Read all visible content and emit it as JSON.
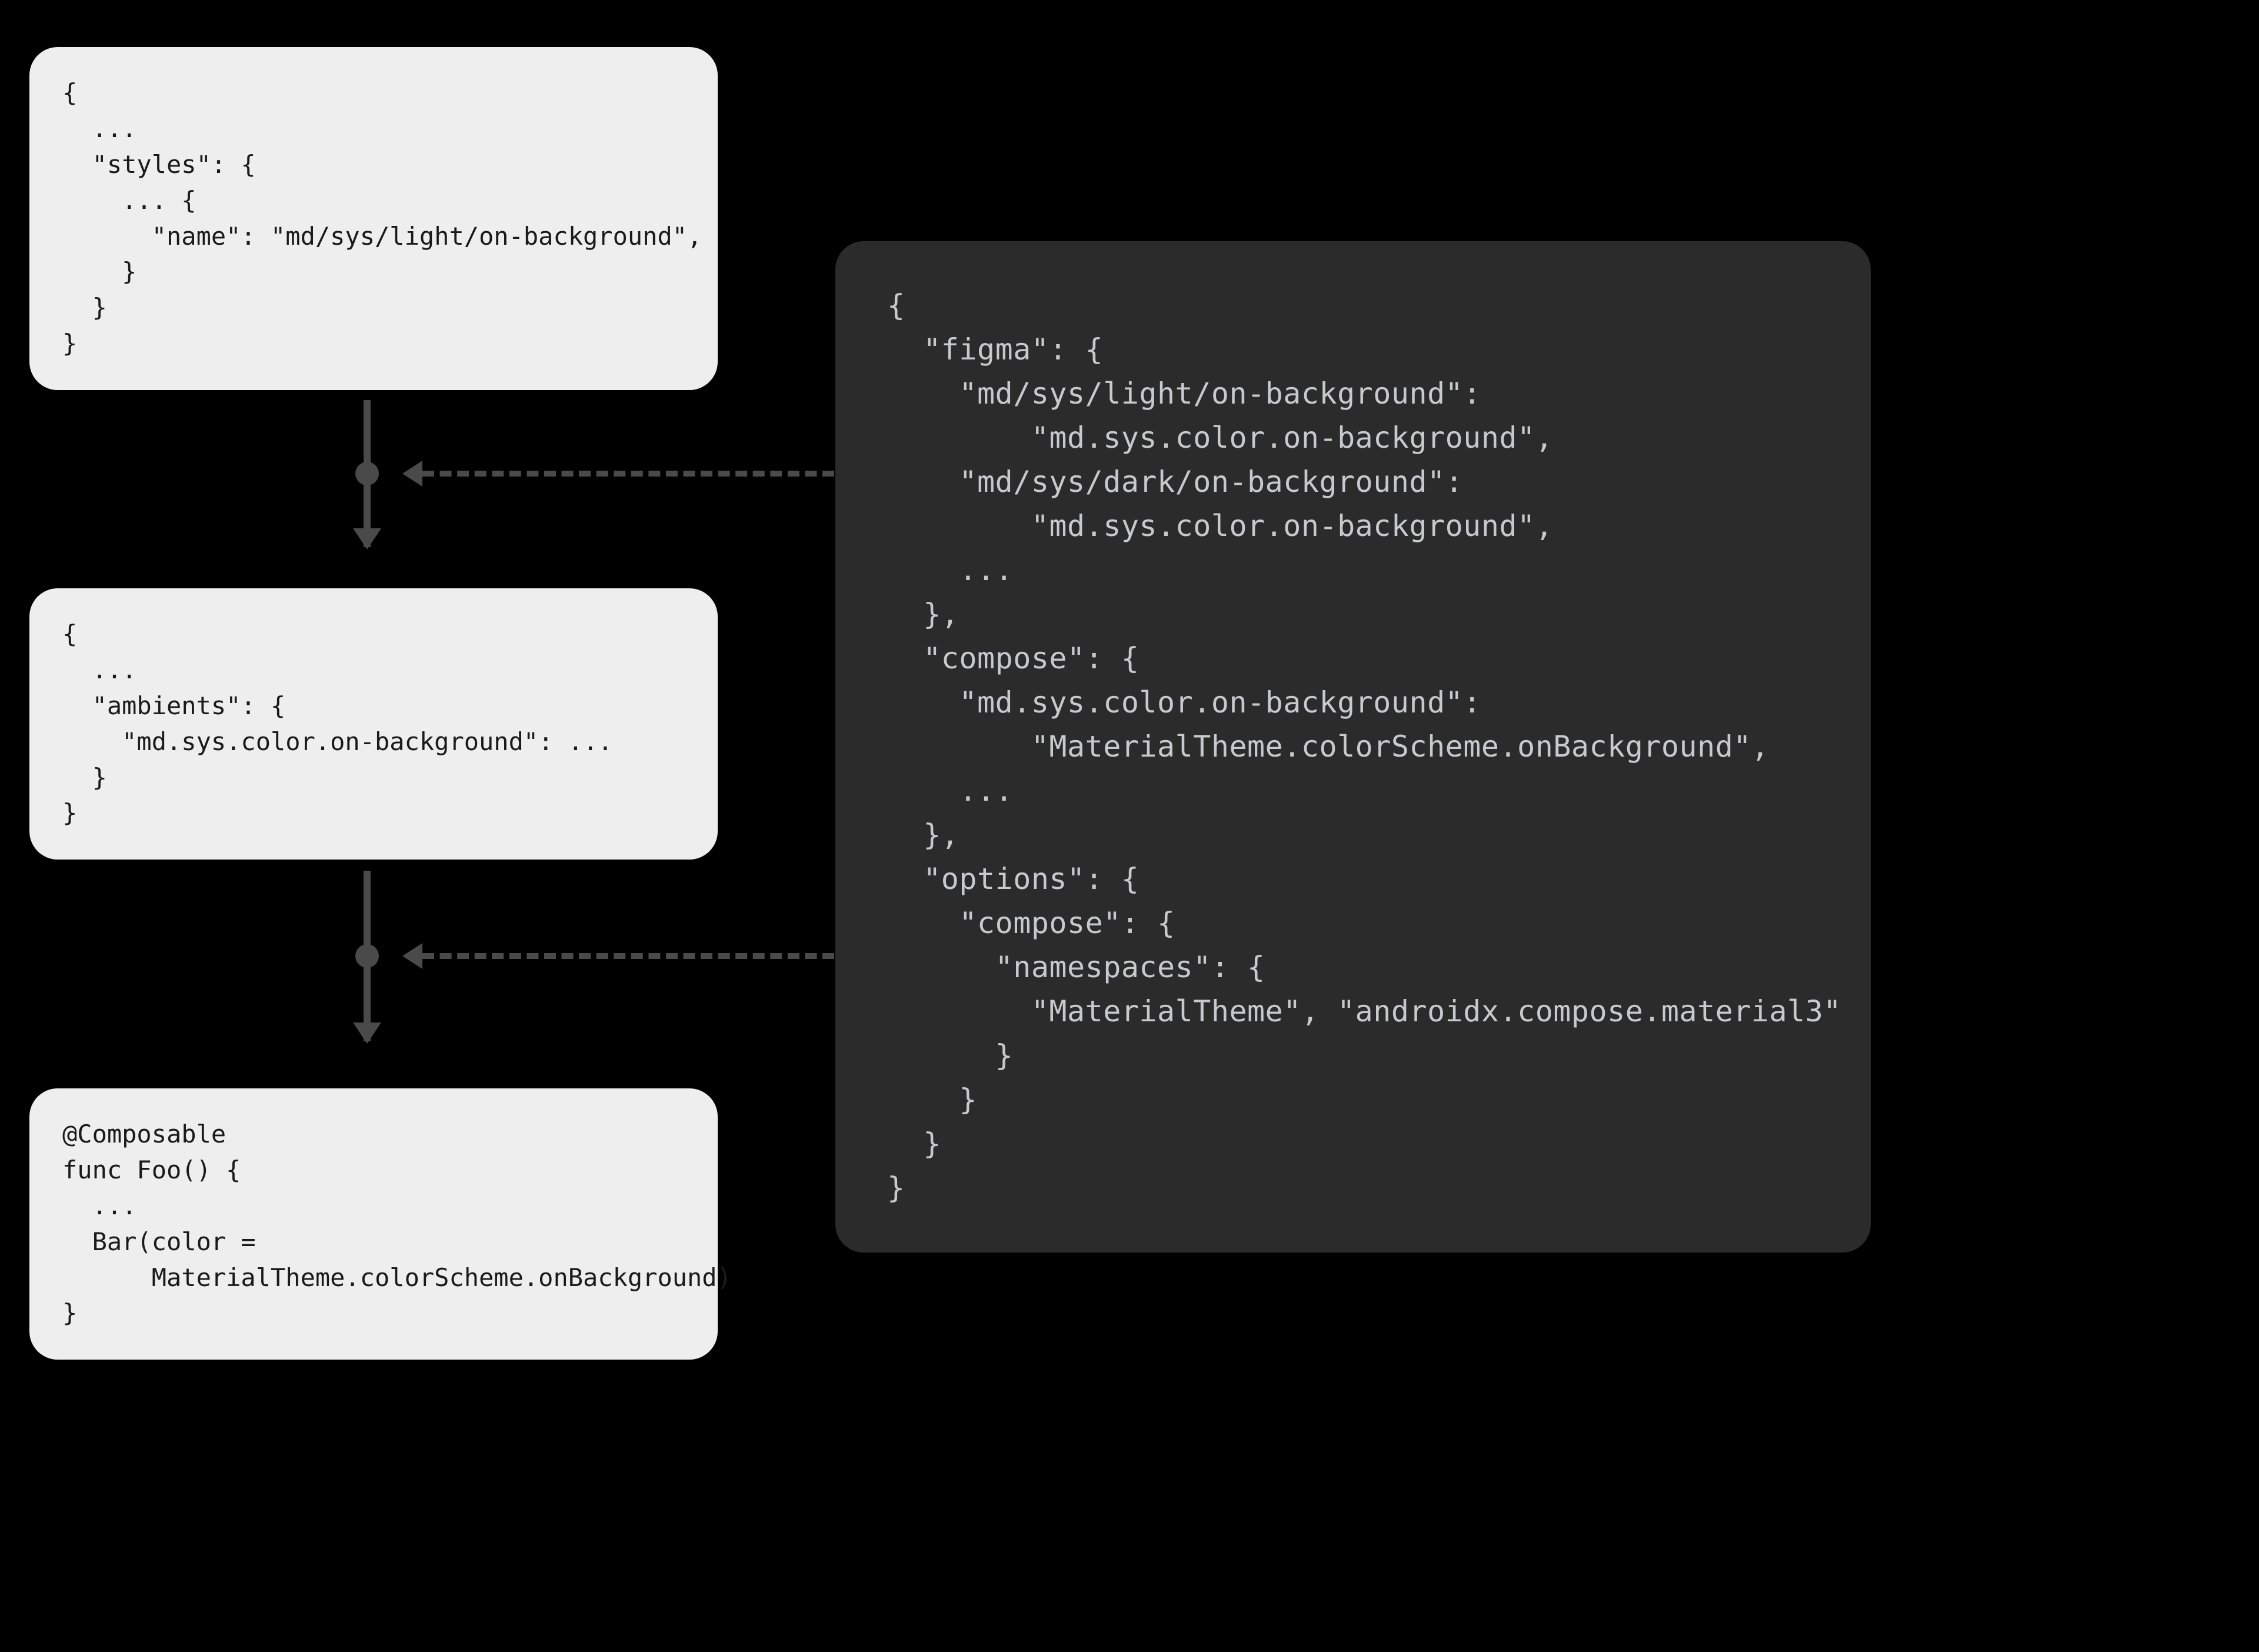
{
  "cards": {
    "styles": "{\n  ...\n  \"styles\": {\n    ... {\n      \"name\": \"md/sys/light/on-background\",\n    }\n  }\n}",
    "ambients": "{\n  ...\n  \"ambients\": {\n    \"md.sys.color.on-background\": ...\n  }\n}",
    "composable": "@Composable\nfunc Foo() {\n  ...\n  Bar(color =\n      MaterialTheme.colorScheme.onBackground)\n}",
    "config": "{\n  \"figma\": {\n    \"md/sys/light/on-background\":\n        \"md.sys.color.on-background\",\n    \"md/sys/dark/on-background\":\n        \"md.sys.color.on-background\",\n    ...\n  },\n  \"compose\": {\n    \"md.sys.color.on-background\":\n        \"MaterialTheme.colorScheme.onBackground\",\n    ...\n  },\n  \"options\": {\n    \"compose\": {\n      \"namespaces\": {\n        \"MaterialTheme\", \"androidx.compose.material3\"\n      }\n    }\n  }\n}"
  }
}
